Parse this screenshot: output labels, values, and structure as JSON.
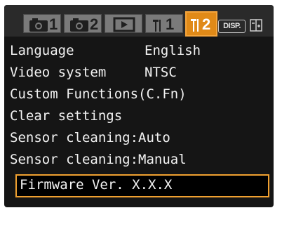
{
  "tabs": [
    {
      "name": "shooting-1",
      "number": "1",
      "active": false
    },
    {
      "name": "shooting-2",
      "number": "2",
      "active": false
    },
    {
      "name": "playback",
      "number": "",
      "active": false
    },
    {
      "name": "setup-1",
      "number": "1",
      "active": false
    },
    {
      "name": "setup-2",
      "number": "2",
      "active": true
    }
  ],
  "badges": {
    "disp": "DISP."
  },
  "menu": {
    "items": [
      {
        "label": "Language",
        "value": "English"
      },
      {
        "label": "Video system",
        "value": "NTSC"
      },
      {
        "label": "Custom Functions(C.Fn)",
        "value": ""
      },
      {
        "label": "Clear settings",
        "value": ""
      },
      {
        "label": "Sensor cleaning:Auto",
        "value": ""
      },
      {
        "label": "Sensor cleaning:Manual",
        "value": ""
      },
      {
        "label": "Firmware Ver. X.X.X",
        "value": ""
      }
    ],
    "selected_index": 6
  },
  "colors": {
    "accent": "#e08a18",
    "highlight_border": "#f0a030",
    "screen_bg": "#151515",
    "text": "#f2f2f2"
  }
}
